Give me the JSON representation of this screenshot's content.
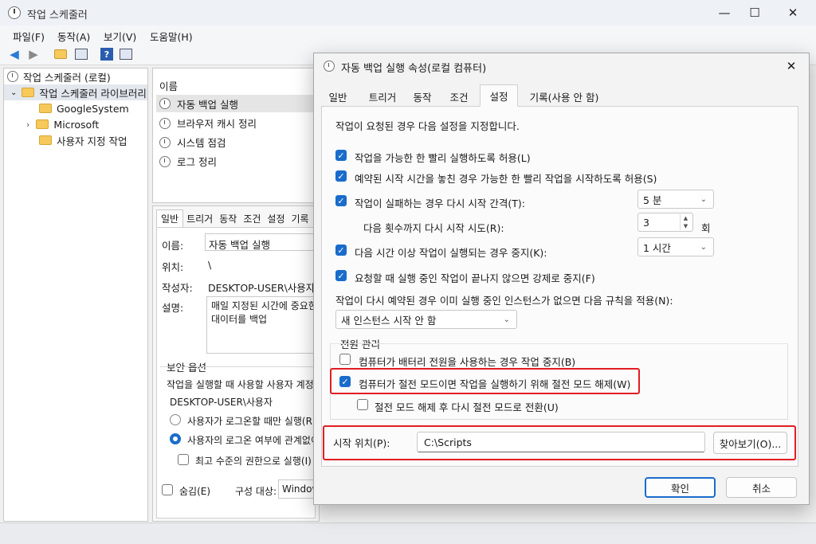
{
  "window": {
    "title": "작업 스케줄러",
    "minimize": "—",
    "maximize": "☐",
    "close": "✕"
  },
  "menu": [
    "파일(F)",
    "동작(A)",
    "보기(V)",
    "도움말(H)"
  ],
  "tree": {
    "root": "작업 스케줄러 (로컬)",
    "library": "작업 스케줄러 라이브러리",
    "children": [
      "GoogleSystem",
      "Microsoft",
      "사용자 지정 작업"
    ]
  },
  "tasklist": {
    "header": "이름",
    "items": [
      "자동 백업 실행",
      "브라우저 캐시 정리",
      "시스템 점검",
      "로그 정리"
    ]
  },
  "detail": {
    "tabs": [
      "일반",
      "트리거",
      "동작",
      "조건",
      "설정",
      "기록"
    ],
    "name_label": "이름:",
    "name_value": "자동 백업 실행",
    "location_label": "위치:",
    "location_value": "\\",
    "author_label": "작성자:",
    "author_value": "DESKTOP-USER\\사용자",
    "desc_label": "설명:",
    "desc_value_line1": "매일 지정된 시간에 중요한",
    "desc_value_line2": "대이터를 백업",
    "security_heading": "보안 옵션",
    "account_label": "작업을 실행할 때 사용할 사용자 계정:",
    "account_value": "DESKTOP-USER\\사용자",
    "radio1": "사용자가 로그온할 때만 실행(R)",
    "radio2": "사용자의 로그온 여부에 관계없이 실",
    "highest": "최고 수준의 권한으로 실행(I)",
    "hidden": "숨김(E)",
    "config_label": "구성 대상:",
    "config_value": "Window"
  },
  "dialog": {
    "title": "자동 백업 실행 속성(로컬 컴퓨터)",
    "close": "✕",
    "tabs": [
      "일반",
      "트리거",
      "동작",
      "조건",
      "설정",
      "기록(사용 안 함)"
    ],
    "active_tab": "설정",
    "intro": "작업이 요청된 경우 다음 설정을 지정합니다.",
    "opt_on_demand": "작업을 가능한 한 빨리 실행하도록 허용(L)",
    "opt_missed": "예약된 시작 시간을 놓친 경우 가능한 한 빨리 작업을 시작하도록 허용(S)",
    "opt_restart": "작업이 실패하는 경우 다시 시작 간격(T):",
    "restart_interval": "5 분",
    "restart_attempts_label": "다음 횟수까지 다시 시작 시도(R):",
    "restart_attempts": "3",
    "restart_unit": "회",
    "opt_stop_long": "다음 시간 이상 작업이 실행되는 경우 중지(K):",
    "stop_duration": "1 시간",
    "opt_force_stop": "요청할 때 실행 중인 작업이 끝나지 않으면 강제로 중지(F)",
    "rule_label": "작업이 다시 예약된 경우 이미 실행 중인 인스턴스가 없으면 다음 규칙을 적용(N):",
    "rule_value": "새 인스턴스 시작 안 함",
    "power_heading": "전원 관리",
    "opt_battery": "컴퓨터가 배터리 전원을 사용하는 경우 작업 중지(B)",
    "opt_wake": "컴퓨터가 절전 모드이면 작업을 실행하기 위해 절전 모드 해제(W)",
    "opt_resleep": "절전 모드 해제 후 다시 절전 모드로 전환(U)",
    "start_in_label": "시작 위치(P):",
    "start_in_value": "C:\\Scripts",
    "browse": "찾아보기(O)...",
    "ok": "확인",
    "cancel": "취소"
  },
  "colors": {
    "accent": "#1a6ccb",
    "highlight": "#e11d24"
  }
}
